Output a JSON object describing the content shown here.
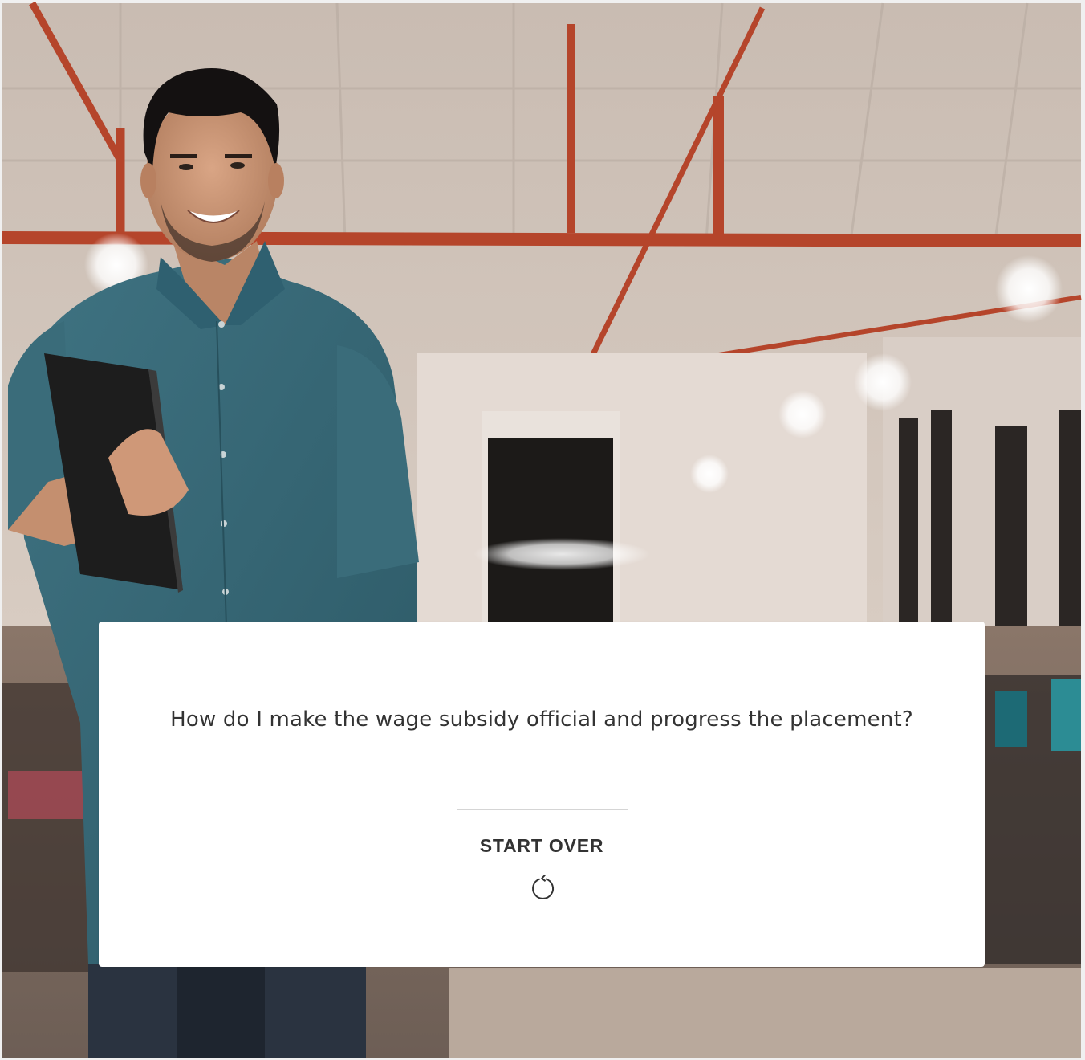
{
  "card": {
    "question": "How do I make the wage subsidy official and progress the placement?",
    "start_over_label": "START OVER",
    "start_over_icon": "restart-icon"
  },
  "background": {
    "description_icon": "office-background-image",
    "person_icon": "man-holding-laptop-image"
  }
}
